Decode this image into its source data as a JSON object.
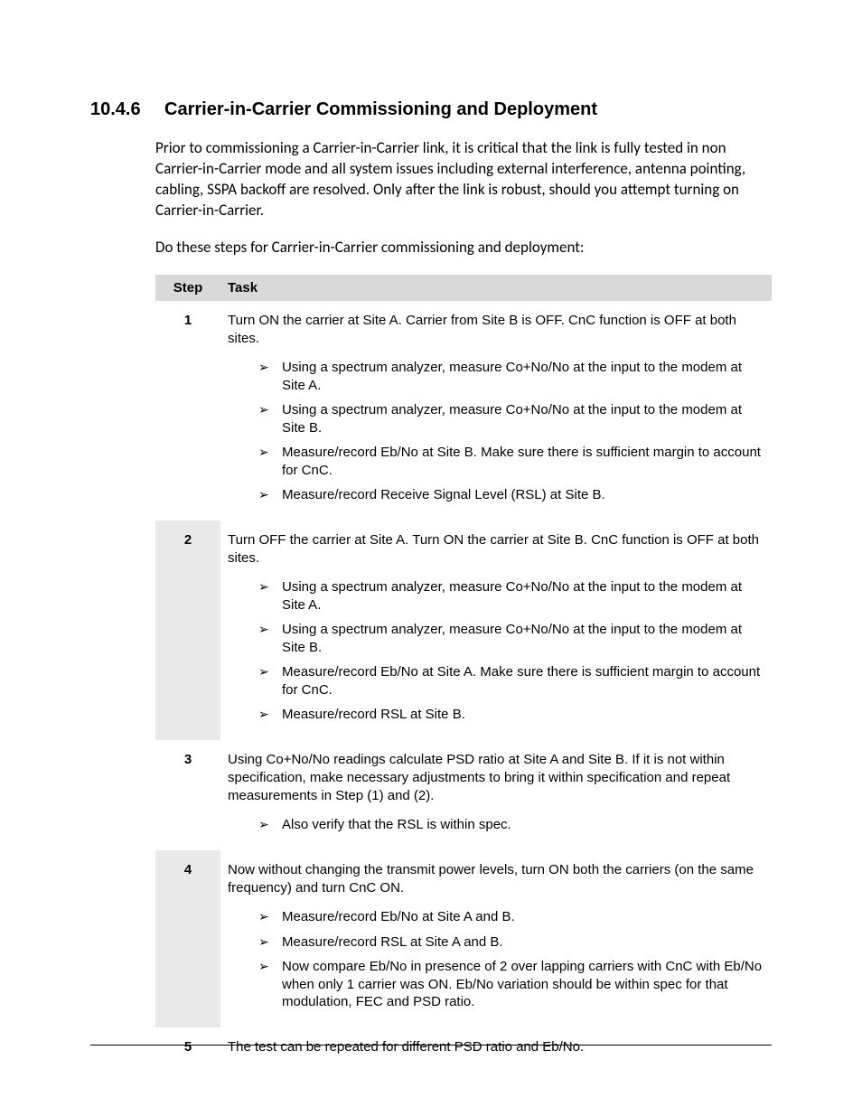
{
  "heading": {
    "number": "10.4.6",
    "title": "Carrier-in-Carrier Commissioning and Deployment"
  },
  "intro": [
    "Prior to commissioning a Carrier-in-Carrier link, it is critical that the link is fully tested in non Carrier-in-Carrier mode and all system issues including external interference, antenna pointing, cabling, SSPA backoff are resolved. Only after the link is robust, should you attempt turning on Carrier-in-Carrier.",
    "Do these steps for Carrier-in-Carrier commissioning and deployment:"
  ],
  "table": {
    "headers": {
      "step": "Step",
      "task": "Task"
    },
    "rows": [
      {
        "step": "1",
        "lead": "Turn ON the carrier at Site A. Carrier from Site B is OFF. CnC function is OFF at both sites.",
        "bullets": [
          "Using a spectrum analyzer, measure Co+No/No at the input to the modem at Site A.",
          "Using a spectrum analyzer, measure Co+No/No at the input to the modem at Site B.",
          "Measure/record Eb/No at Site B. Make sure there is sufficient margin to account for CnC.",
          "Measure/record Receive Signal Level (RSL) at Site B."
        ]
      },
      {
        "step": "2",
        "lead": "Turn OFF the carrier at Site A. Turn ON the carrier at Site B. CnC function is OFF at both sites.",
        "bullets": [
          "Using a spectrum analyzer, measure Co+No/No at the input to the modem at Site A.",
          "Using a spectrum analyzer, measure Co+No/No at the input to the modem at Site B.",
          "Measure/record Eb/No at Site A. Make sure there is sufficient margin to account for CnC.",
          "Measure/record RSL at Site B."
        ]
      },
      {
        "step": "3",
        "lead": "Using Co+No/No readings calculate PSD ratio at Site A and Site B. If it is not within specification,  make necessary adjustments to bring it within specification and repeat measurements in Step (1) and (2).",
        "bullets": [
          "Also verify that the RSL is within spec."
        ]
      },
      {
        "step": "4",
        "lead": "Now without changing the transmit power levels, turn ON both the carriers (on the same frequency) and turn CnC ON.",
        "bullets": [
          "Measure/record Eb/No at Site A and B.",
          "Measure/record RSL at Site A and B.",
          "Now compare Eb/No in presence of 2 over lapping carriers with CnC with Eb/No when only 1 carrier was ON. Eb/No variation should be within spec for that modulation, FEC and PSD ratio."
        ]
      },
      {
        "step": "5",
        "lead": "The test can be repeated for different PSD ratio and Eb/No.",
        "bullets": []
      }
    ]
  }
}
